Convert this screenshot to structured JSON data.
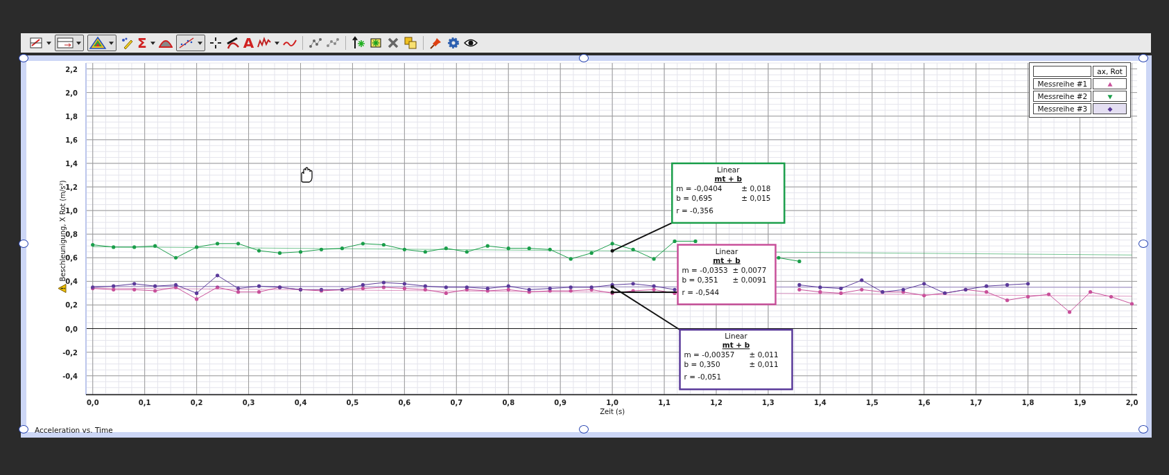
{
  "toolbar": {
    "sum_tool": "Σ",
    "label_tool": "A"
  },
  "chart": {
    "title": "Acceleration vs. Time",
    "y_warning": true,
    "chart_data": {
      "type": "line",
      "xlabel": "Zeit (s)",
      "ylabel": "Beschleunigung, X Rot (m/s²)",
      "grid": true,
      "xlim": [
        -0.013,
        2.01
      ],
      "ylim": [
        -0.56,
        2.25
      ],
      "xticks": [
        {
          "value": 0,
          "label": "0,0"
        },
        {
          "value": 0.1,
          "label": "0,1"
        },
        {
          "value": 0.2,
          "label": "0,2"
        },
        {
          "value": 0.3,
          "label": "0,3"
        },
        {
          "value": 0.4,
          "label": "0,4"
        },
        {
          "value": 0.5,
          "label": "0,5"
        },
        {
          "value": 0.6,
          "label": "0,6"
        },
        {
          "value": 0.7,
          "label": "0,7"
        },
        {
          "value": 0.8,
          "label": "0,8"
        },
        {
          "value": 0.9,
          "label": "0,9"
        },
        {
          "value": 1.0,
          "label": "1,0"
        },
        {
          "value": 1.1,
          "label": "1,1"
        },
        {
          "value": 1.2,
          "label": "1,2"
        },
        {
          "value": 1.3,
          "label": "1,3"
        },
        {
          "value": 1.4,
          "label": "1,4"
        },
        {
          "value": 1.5,
          "label": "1,5"
        },
        {
          "value": 1.6,
          "label": "1,6"
        },
        {
          "value": 1.7,
          "label": "1,7"
        },
        {
          "value": 1.8,
          "label": "1,8"
        },
        {
          "value": 1.9,
          "label": "1,9"
        },
        {
          "value": 2.0,
          "label": "2,0"
        }
      ],
      "yticks": [
        {
          "value": -0.4,
          "label": "-0,4"
        },
        {
          "value": -0.2,
          "label": "-0,2"
        },
        {
          "value": 0,
          "label": "0,0"
        },
        {
          "value": 0.2,
          "label": "0,2"
        },
        {
          "value": 0.4,
          "label": "0,4"
        },
        {
          "value": 0.6,
          "label": "0,6"
        },
        {
          "value": 0.8,
          "label": "0,8"
        },
        {
          "value": 1.0,
          "label": "1,0"
        },
        {
          "value": 1.2,
          "label": "1,2"
        },
        {
          "value": 1.4,
          "label": "1,4"
        },
        {
          "value": 1.6,
          "label": "1,6"
        },
        {
          "value": 1.8,
          "label": "1,8"
        },
        {
          "value": 2.0,
          "label": "2,0"
        },
        {
          "value": 2.2,
          "label": "2,2"
        }
      ],
      "x": [
        0,
        0.04,
        0.08,
        0.12,
        0.16,
        0.2,
        0.24,
        0.28,
        0.32,
        0.36,
        0.4,
        0.44,
        0.48,
        0.52,
        0.56,
        0.6,
        0.64,
        0.68,
        0.72,
        0.76,
        0.8,
        0.84,
        0.88,
        0.92,
        0.96,
        1.0,
        1.04,
        1.08,
        1.12,
        1.16,
        1.2,
        1.24,
        1.28,
        1.32,
        1.36,
        1.4,
        1.44,
        1.48,
        1.52,
        1.56,
        1.6,
        1.64,
        1.68,
        1.72,
        1.76,
        1.8,
        1.84,
        1.88,
        1.92,
        1.96,
        2.0
      ],
      "series": [
        {
          "name": "Messreihe #1",
          "color": "#c8509a",
          "values": [
            0.34,
            0.33,
            0.33,
            0.32,
            0.35,
            0.25,
            0.35,
            0.31,
            0.31,
            0.35,
            0.33,
            0.32,
            0.33,
            0.34,
            0.35,
            0.34,
            0.33,
            0.3,
            0.33,
            0.32,
            0.33,
            0.31,
            0.32,
            0.32,
            0.33,
            0.3,
            0.32,
            0.33,
            0.3,
            null,
            null,
            null,
            null,
            null,
            0.33,
            0.31,
            0.3,
            0.33,
            0.31,
            0.31,
            0.28,
            0.3,
            0.33,
            0.31,
            0.24,
            0.27,
            0.29,
            0.14,
            0.31,
            0.27,
            0.21
          ]
        },
        {
          "name": "Messreihe #2",
          "color": "#1a9e4a",
          "values": [
            0.71,
            0.69,
            0.69,
            0.7,
            0.6,
            0.69,
            0.72,
            0.72,
            0.66,
            0.64,
            0.65,
            0.67,
            0.68,
            0.72,
            0.71,
            0.67,
            0.65,
            0.68,
            0.65,
            0.7,
            0.68,
            0.68,
            0.67,
            0.59,
            0.64,
            0.72,
            0.67,
            0.59,
            0.74,
            0.74,
            null,
            null,
            null,
            0.6,
            0.57,
            null,
            null,
            null,
            null,
            null,
            null,
            null,
            null,
            null,
            null,
            null,
            null,
            null,
            null,
            null,
            null
          ]
        },
        {
          "name": "Messreihe #3",
          "color": "#5a3a9a",
          "values": [
            0.35,
            0.36,
            0.38,
            0.36,
            0.37,
            0.3,
            0.45,
            0.34,
            0.36,
            0.35,
            0.33,
            0.33,
            0.33,
            0.37,
            0.39,
            0.38,
            0.36,
            0.35,
            0.35,
            0.34,
            0.36,
            0.33,
            0.34,
            0.35,
            0.35,
            0.37,
            0.38,
            0.36,
            0.33,
            null,
            null,
            null,
            null,
            null,
            0.37,
            0.35,
            0.34,
            0.41,
            0.31,
            0.33,
            0.38,
            0.3,
            0.33,
            0.36,
            0.37,
            0.38,
            null,
            null,
            null,
            null,
            null
          ]
        }
      ]
    },
    "fits": [
      {
        "title": "Linear",
        "formula": "mt + b",
        "m": "m = -0,0404",
        "m_err": "± 0,018",
        "b": "b  = 0,695",
        "b_err": "± 0,015",
        "r": "r = -0,356"
      },
      {
        "title": "Linear",
        "formula": "mt + b",
        "m": "m = -0,0353",
        "m_err": "± 0,0077",
        "b": "b  = 0,351",
        "b_err": "± 0,0091",
        "r": "r = -0,544"
      },
      {
        "title": "Linear",
        "formula": "mt + b",
        "m": "m = -0,00357",
        "m_err": "± 0,011",
        "b": "b  = 0,350",
        "b_err": "± 0,011",
        "r": "r = -0,051"
      }
    ]
  },
  "legend": {
    "header": "ax, Rot",
    "rows": [
      {
        "kind": "triangle-up",
        "selected": false
      },
      {
        "kind": "triangle-down",
        "selected": false
      },
      {
        "kind": "diamond",
        "selected": true
      }
    ]
  }
}
